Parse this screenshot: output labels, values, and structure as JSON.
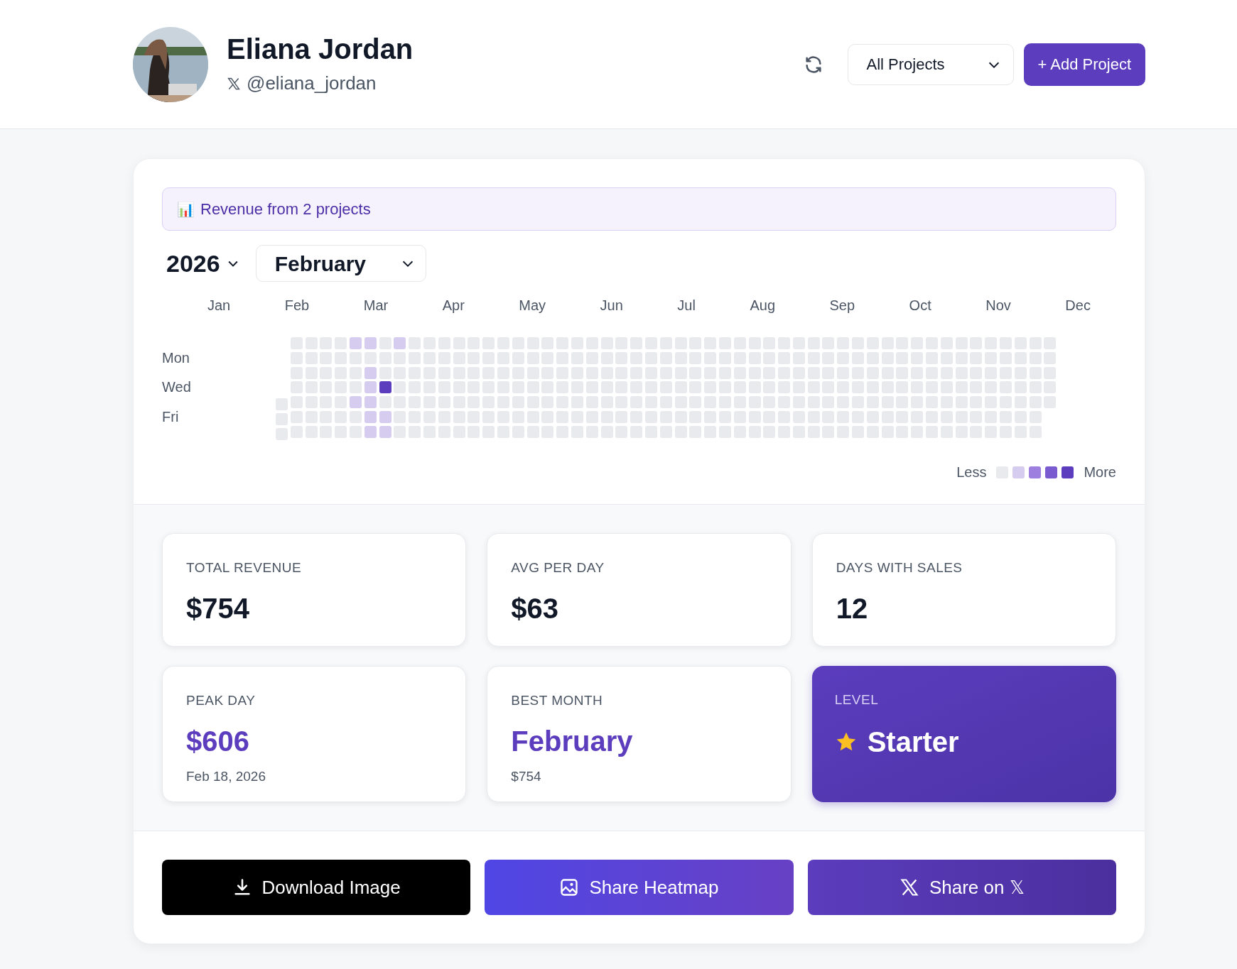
{
  "profile": {
    "name": "Eliana Jordan",
    "handle": "@eliana_jordan"
  },
  "header_controls": {
    "project_select": "All Projects",
    "add_button": "+ Add Project"
  },
  "banner": {
    "icon": "📊",
    "text": "Revenue from 2 projects"
  },
  "period": {
    "year": "2026",
    "month": "February"
  },
  "heatmap": {
    "months": [
      "Jan",
      "Feb",
      "Mar",
      "Apr",
      "May",
      "Jun",
      "Jul",
      "Aug",
      "Sep",
      "Oct",
      "Nov",
      "Dec"
    ],
    "day_labels": [
      "Mon",
      "Wed",
      "Fri"
    ],
    "weeks": [
      {
        "days": [
          {
            "color": "#e9eaee"
          },
          {
            "color": "#e9eaee"
          },
          {
            "color": "#e9eaee"
          }
        ]
      },
      {
        "days": [
          {
            "color": "#e9eaee"
          },
          {
            "color": "#e9eaee"
          },
          {
            "color": "#e9eaee"
          },
          {
            "color": "#e9eaee"
          },
          {
            "color": "#e9eaee"
          },
          {
            "color": "#e9eaee"
          },
          {
            "color": "#e9eaee"
          }
        ]
      },
      {
        "days": [
          {
            "color": "#e9eaee"
          },
          {
            "color": "#e9eaee"
          },
          {
            "color": "#e9eaee"
          },
          {
            "color": "#e9eaee"
          },
          {
            "color": "#e9eaee"
          },
          {
            "color": "#e9eaee"
          },
          {
            "color": "#e9eaee"
          }
        ]
      },
      {
        "days": [
          {
            "color": "#e9eaee"
          },
          {
            "color": "#e9eaee"
          },
          {
            "color": "#e9eaee"
          },
          {
            "color": "#e9eaee"
          },
          {
            "color": "#e9eaee"
          },
          {
            "color": "#e9eaee"
          },
          {
            "color": "#e9eaee"
          }
        ]
      },
      {
        "days": [
          {
            "color": "#e9eaee"
          },
          {
            "color": "#e9eaee"
          },
          {
            "color": "#e9eaee"
          },
          {
            "color": "#e9eaee"
          },
          {
            "color": "#e9eaee"
          },
          {
            "color": "#e9eaee"
          },
          {
            "color": "#e9eaee"
          }
        ]
      },
      {
        "days": [
          {
            "color": "#d6ccf0"
          },
          {
            "color": "#e9eaee"
          },
          {
            "color": "#e9eaee"
          },
          {
            "color": "#e9eaee"
          },
          {
            "color": "#d6ccf0"
          },
          {
            "color": "#e9eaee"
          },
          {
            "color": "#e9eaee"
          }
        ]
      },
      {
        "days": [
          {
            "color": "#d6ccf0"
          },
          {
            "color": "#e9eaee"
          },
          {
            "color": "#d6ccf0"
          },
          {
            "color": "#d6ccf0"
          },
          {
            "color": "#d6ccf0"
          },
          {
            "color": "#d6ccf0"
          },
          {
            "color": "#d6ccf0"
          }
        ]
      },
      {
        "days": [
          {
            "color": "#e9eaee"
          },
          {
            "color": "#e9eaee"
          },
          {
            "color": "#e9eaee"
          },
          {
            "color": "#5b3dbd"
          },
          {
            "color": "#e9eaee"
          },
          {
            "color": "#d6ccf0"
          },
          {
            "color": "#d6ccf0"
          }
        ]
      },
      {
        "days": [
          {
            "color": "#d6ccf0"
          },
          {
            "color": "#e9eaee"
          },
          {
            "color": "#e9eaee"
          },
          {
            "color": "#e9eaee"
          },
          {
            "color": "#e9eaee"
          },
          {
            "color": "#e9eaee"
          },
          {
            "color": "#e9eaee"
          }
        ]
      },
      {
        "days": [
          {
            "color": "#e9eaee"
          },
          {
            "color": "#e9eaee"
          },
          {
            "color": "#e9eaee"
          },
          {
            "color": "#e9eaee"
          },
          {
            "color": "#e9eaee"
          },
          {
            "color": "#e9eaee"
          },
          {
            "color": "#e9eaee"
          }
        ]
      },
      {
        "days": [
          {
            "color": "#e9eaee"
          },
          {
            "color": "#e9eaee"
          },
          {
            "color": "#e9eaee"
          },
          {
            "color": "#e9eaee"
          },
          {
            "color": "#e9eaee"
          },
          {
            "color": "#e9eaee"
          },
          {
            "color": "#e9eaee"
          }
        ]
      },
      {
        "days": [
          {
            "color": "#e9eaee"
          },
          {
            "color": "#e9eaee"
          },
          {
            "color": "#e9eaee"
          },
          {
            "color": "#e9eaee"
          },
          {
            "color": "#e9eaee"
          },
          {
            "color": "#e9eaee"
          },
          {
            "color": "#e9eaee"
          }
        ]
      },
      {
        "days": [
          {
            "color": "#e9eaee"
          },
          {
            "color": "#e9eaee"
          },
          {
            "color": "#e9eaee"
          },
          {
            "color": "#e9eaee"
          },
          {
            "color": "#e9eaee"
          },
          {
            "color": "#e9eaee"
          },
          {
            "color": "#e9eaee"
          }
        ]
      },
      {
        "days": [
          {
            "color": "#e9eaee"
          },
          {
            "color": "#e9eaee"
          },
          {
            "color": "#e9eaee"
          },
          {
            "color": "#e9eaee"
          },
          {
            "color": "#e9eaee"
          },
          {
            "color": "#e9eaee"
          },
          {
            "color": "#e9eaee"
          }
        ]
      },
      {
        "days": [
          {
            "color": "#e9eaee"
          },
          {
            "color": "#e9eaee"
          },
          {
            "color": "#e9eaee"
          },
          {
            "color": "#e9eaee"
          },
          {
            "color": "#e9eaee"
          },
          {
            "color": "#e9eaee"
          },
          {
            "color": "#e9eaee"
          }
        ]
      },
      {
        "days": [
          {
            "color": "#e9eaee"
          },
          {
            "color": "#e9eaee"
          },
          {
            "color": "#e9eaee"
          },
          {
            "color": "#e9eaee"
          },
          {
            "color": "#e9eaee"
          },
          {
            "color": "#e9eaee"
          },
          {
            "color": "#e9eaee"
          }
        ]
      },
      {
        "days": [
          {
            "color": "#e9eaee"
          },
          {
            "color": "#e9eaee"
          },
          {
            "color": "#e9eaee"
          },
          {
            "color": "#e9eaee"
          },
          {
            "color": "#e9eaee"
          },
          {
            "color": "#e9eaee"
          },
          {
            "color": "#e9eaee"
          }
        ]
      },
      {
        "days": [
          {
            "color": "#e9eaee"
          },
          {
            "color": "#e9eaee"
          },
          {
            "color": "#e9eaee"
          },
          {
            "color": "#e9eaee"
          },
          {
            "color": "#e9eaee"
          },
          {
            "color": "#e9eaee"
          },
          {
            "color": "#e9eaee"
          }
        ]
      },
      {
        "days": [
          {
            "color": "#e9eaee"
          },
          {
            "color": "#e9eaee"
          },
          {
            "color": "#e9eaee"
          },
          {
            "color": "#e9eaee"
          },
          {
            "color": "#e9eaee"
          },
          {
            "color": "#e9eaee"
          },
          {
            "color": "#e9eaee"
          }
        ]
      },
      {
        "days": [
          {
            "color": "#e9eaee"
          },
          {
            "color": "#e9eaee"
          },
          {
            "color": "#e9eaee"
          },
          {
            "color": "#e9eaee"
          },
          {
            "color": "#e9eaee"
          },
          {
            "color": "#e9eaee"
          },
          {
            "color": "#e9eaee"
          }
        ]
      },
      {
        "days": [
          {
            "color": "#e9eaee"
          },
          {
            "color": "#e9eaee"
          },
          {
            "color": "#e9eaee"
          },
          {
            "color": "#e9eaee"
          },
          {
            "color": "#e9eaee"
          },
          {
            "color": "#e9eaee"
          },
          {
            "color": "#e9eaee"
          }
        ]
      },
      {
        "days": [
          {
            "color": "#e9eaee"
          },
          {
            "color": "#e9eaee"
          },
          {
            "color": "#e9eaee"
          },
          {
            "color": "#e9eaee"
          },
          {
            "color": "#e9eaee"
          },
          {
            "color": "#e9eaee"
          },
          {
            "color": "#e9eaee"
          }
        ]
      },
      {
        "days": [
          {
            "color": "#e9eaee"
          },
          {
            "color": "#e9eaee"
          },
          {
            "color": "#e9eaee"
          },
          {
            "color": "#e9eaee"
          },
          {
            "color": "#e9eaee"
          },
          {
            "color": "#e9eaee"
          },
          {
            "color": "#e9eaee"
          }
        ]
      },
      {
        "days": [
          {
            "color": "#e9eaee"
          },
          {
            "color": "#e9eaee"
          },
          {
            "color": "#e9eaee"
          },
          {
            "color": "#e9eaee"
          },
          {
            "color": "#e9eaee"
          },
          {
            "color": "#e9eaee"
          },
          {
            "color": "#e9eaee"
          }
        ]
      },
      {
        "days": [
          {
            "color": "#e9eaee"
          },
          {
            "color": "#e9eaee"
          },
          {
            "color": "#e9eaee"
          },
          {
            "color": "#e9eaee"
          },
          {
            "color": "#e9eaee"
          },
          {
            "color": "#e9eaee"
          },
          {
            "color": "#e9eaee"
          }
        ]
      },
      {
        "days": [
          {
            "color": "#e9eaee"
          },
          {
            "color": "#e9eaee"
          },
          {
            "color": "#e9eaee"
          },
          {
            "color": "#e9eaee"
          },
          {
            "color": "#e9eaee"
          },
          {
            "color": "#e9eaee"
          },
          {
            "color": "#e9eaee"
          }
        ]
      },
      {
        "days": [
          {
            "color": "#e9eaee"
          },
          {
            "color": "#e9eaee"
          },
          {
            "color": "#e9eaee"
          },
          {
            "color": "#e9eaee"
          },
          {
            "color": "#e9eaee"
          },
          {
            "color": "#e9eaee"
          },
          {
            "color": "#e9eaee"
          }
        ]
      },
      {
        "days": [
          {
            "color": "#e9eaee"
          },
          {
            "color": "#e9eaee"
          },
          {
            "color": "#e9eaee"
          },
          {
            "color": "#e9eaee"
          },
          {
            "color": "#e9eaee"
          },
          {
            "color": "#e9eaee"
          },
          {
            "color": "#e9eaee"
          }
        ]
      },
      {
        "days": [
          {
            "color": "#e9eaee"
          },
          {
            "color": "#e9eaee"
          },
          {
            "color": "#e9eaee"
          },
          {
            "color": "#e9eaee"
          },
          {
            "color": "#e9eaee"
          },
          {
            "color": "#e9eaee"
          },
          {
            "color": "#e9eaee"
          }
        ]
      },
      {
        "days": [
          {
            "color": "#e9eaee"
          },
          {
            "color": "#e9eaee"
          },
          {
            "color": "#e9eaee"
          },
          {
            "color": "#e9eaee"
          },
          {
            "color": "#e9eaee"
          },
          {
            "color": "#e9eaee"
          },
          {
            "color": "#e9eaee"
          }
        ]
      },
      {
        "days": [
          {
            "color": "#e9eaee"
          },
          {
            "color": "#e9eaee"
          },
          {
            "color": "#e9eaee"
          },
          {
            "color": "#e9eaee"
          },
          {
            "color": "#e9eaee"
          },
          {
            "color": "#e9eaee"
          },
          {
            "color": "#e9eaee"
          }
        ]
      },
      {
        "days": [
          {
            "color": "#e9eaee"
          },
          {
            "color": "#e9eaee"
          },
          {
            "color": "#e9eaee"
          },
          {
            "color": "#e9eaee"
          },
          {
            "color": "#e9eaee"
          },
          {
            "color": "#e9eaee"
          },
          {
            "color": "#e9eaee"
          }
        ]
      },
      {
        "days": [
          {
            "color": "#e9eaee"
          },
          {
            "color": "#e9eaee"
          },
          {
            "color": "#e9eaee"
          },
          {
            "color": "#e9eaee"
          },
          {
            "color": "#e9eaee"
          },
          {
            "color": "#e9eaee"
          },
          {
            "color": "#e9eaee"
          }
        ]
      },
      {
        "days": [
          {
            "color": "#e9eaee"
          },
          {
            "color": "#e9eaee"
          },
          {
            "color": "#e9eaee"
          },
          {
            "color": "#e9eaee"
          },
          {
            "color": "#e9eaee"
          },
          {
            "color": "#e9eaee"
          },
          {
            "color": "#e9eaee"
          }
        ]
      },
      {
        "days": [
          {
            "color": "#e9eaee"
          },
          {
            "color": "#e9eaee"
          },
          {
            "color": "#e9eaee"
          },
          {
            "color": "#e9eaee"
          },
          {
            "color": "#e9eaee"
          },
          {
            "color": "#e9eaee"
          },
          {
            "color": "#e9eaee"
          }
        ]
      },
      {
        "days": [
          {
            "color": "#e9eaee"
          },
          {
            "color": "#e9eaee"
          },
          {
            "color": "#e9eaee"
          },
          {
            "color": "#e9eaee"
          },
          {
            "color": "#e9eaee"
          },
          {
            "color": "#e9eaee"
          },
          {
            "color": "#e9eaee"
          }
        ]
      },
      {
        "days": [
          {
            "color": "#e9eaee"
          },
          {
            "color": "#e9eaee"
          },
          {
            "color": "#e9eaee"
          },
          {
            "color": "#e9eaee"
          },
          {
            "color": "#e9eaee"
          },
          {
            "color": "#e9eaee"
          },
          {
            "color": "#e9eaee"
          }
        ]
      },
      {
        "days": [
          {
            "color": "#e9eaee"
          },
          {
            "color": "#e9eaee"
          },
          {
            "color": "#e9eaee"
          },
          {
            "color": "#e9eaee"
          },
          {
            "color": "#e9eaee"
          },
          {
            "color": "#e9eaee"
          },
          {
            "color": "#e9eaee"
          }
        ]
      },
      {
        "days": [
          {
            "color": "#e9eaee"
          },
          {
            "color": "#e9eaee"
          },
          {
            "color": "#e9eaee"
          },
          {
            "color": "#e9eaee"
          },
          {
            "color": "#e9eaee"
          },
          {
            "color": "#e9eaee"
          },
          {
            "color": "#e9eaee"
          }
        ]
      },
      {
        "days": [
          {
            "color": "#e9eaee"
          },
          {
            "color": "#e9eaee"
          },
          {
            "color": "#e9eaee"
          },
          {
            "color": "#e9eaee"
          },
          {
            "color": "#e9eaee"
          },
          {
            "color": "#e9eaee"
          },
          {
            "color": "#e9eaee"
          }
        ]
      },
      {
        "days": [
          {
            "color": "#e9eaee"
          },
          {
            "color": "#e9eaee"
          },
          {
            "color": "#e9eaee"
          },
          {
            "color": "#e9eaee"
          },
          {
            "color": "#e9eaee"
          },
          {
            "color": "#e9eaee"
          },
          {
            "color": "#e9eaee"
          }
        ]
      },
      {
        "days": [
          {
            "color": "#e9eaee"
          },
          {
            "color": "#e9eaee"
          },
          {
            "color": "#e9eaee"
          },
          {
            "color": "#e9eaee"
          },
          {
            "color": "#e9eaee"
          },
          {
            "color": "#e9eaee"
          },
          {
            "color": "#e9eaee"
          }
        ]
      },
      {
        "days": [
          {
            "color": "#e9eaee"
          },
          {
            "color": "#e9eaee"
          },
          {
            "color": "#e9eaee"
          },
          {
            "color": "#e9eaee"
          },
          {
            "color": "#e9eaee"
          },
          {
            "color": "#e9eaee"
          },
          {
            "color": "#e9eaee"
          }
        ]
      },
      {
        "days": [
          {
            "color": "#e9eaee"
          },
          {
            "color": "#e9eaee"
          },
          {
            "color": "#e9eaee"
          },
          {
            "color": "#e9eaee"
          },
          {
            "color": "#e9eaee"
          },
          {
            "color": "#e9eaee"
          },
          {
            "color": "#e9eaee"
          }
        ]
      },
      {
        "days": [
          {
            "color": "#e9eaee"
          },
          {
            "color": "#e9eaee"
          },
          {
            "color": "#e9eaee"
          },
          {
            "color": "#e9eaee"
          },
          {
            "color": "#e9eaee"
          },
          {
            "color": "#e9eaee"
          },
          {
            "color": "#e9eaee"
          }
        ]
      },
      {
        "days": [
          {
            "color": "#e9eaee"
          },
          {
            "color": "#e9eaee"
          },
          {
            "color": "#e9eaee"
          },
          {
            "color": "#e9eaee"
          },
          {
            "color": "#e9eaee"
          },
          {
            "color": "#e9eaee"
          },
          {
            "color": "#e9eaee"
          }
        ]
      },
      {
        "days": [
          {
            "color": "#e9eaee"
          },
          {
            "color": "#e9eaee"
          },
          {
            "color": "#e9eaee"
          },
          {
            "color": "#e9eaee"
          },
          {
            "color": "#e9eaee"
          },
          {
            "color": "#e9eaee"
          },
          {
            "color": "#e9eaee"
          }
        ]
      },
      {
        "days": [
          {
            "color": "#e9eaee"
          },
          {
            "color": "#e9eaee"
          },
          {
            "color": "#e9eaee"
          },
          {
            "color": "#e9eaee"
          },
          {
            "color": "#e9eaee"
          },
          {
            "color": "#e9eaee"
          },
          {
            "color": "#e9eaee"
          }
        ]
      },
      {
        "days": [
          {
            "color": "#e9eaee"
          },
          {
            "color": "#e9eaee"
          },
          {
            "color": "#e9eaee"
          },
          {
            "color": "#e9eaee"
          },
          {
            "color": "#e9eaee"
          },
          {
            "color": "#e9eaee"
          },
          {
            "color": "#e9eaee"
          }
        ]
      },
      {
        "days": [
          {
            "color": "#e9eaee"
          },
          {
            "color": "#e9eaee"
          },
          {
            "color": "#e9eaee"
          },
          {
            "color": "#e9eaee"
          },
          {
            "color": "#e9eaee"
          },
          {
            "color": "#e9eaee"
          },
          {
            "color": "#e9eaee"
          }
        ]
      },
      {
        "days": [
          {
            "color": "#e9eaee"
          },
          {
            "color": "#e9eaee"
          },
          {
            "color": "#e9eaee"
          },
          {
            "color": "#e9eaee"
          },
          {
            "color": "#e9eaee"
          },
          {
            "color": "#e9eaee"
          },
          {
            "color": "#e9eaee"
          }
        ]
      },
      {
        "days": [
          {
            "color": "#e9eaee"
          },
          {
            "color": "#e9eaee"
          },
          {
            "color": "#e9eaee"
          },
          {
            "color": "#e9eaee"
          },
          {
            "color": "#e9eaee"
          },
          {
            "color": "#e9eaee"
          },
          {
            "color": "#e9eaee"
          }
        ]
      },
      {
        "days": [
          {
            "color": "#e9eaee"
          },
          {
            "color": "#e9eaee"
          },
          {
            "color": "#e9eaee"
          },
          {
            "color": "#e9eaee"
          },
          {
            "color": "#e9eaee"
          }
        ]
      }
    ],
    "legend": {
      "less": "Less",
      "more": "More",
      "swatches": [
        {
          "color": "#e9eaee"
        },
        {
          "color": "#d6ccf0"
        },
        {
          "color": "#9d7fe0"
        },
        {
          "color": "#7a5bd0"
        },
        {
          "color": "#5b3dbd"
        }
      ]
    }
  },
  "stats": [
    {
      "kind": "plain",
      "label": "TOTAL REVENUE",
      "value": "$754"
    },
    {
      "kind": "plain",
      "label": "AVG PER DAY",
      "value": "$63"
    },
    {
      "kind": "plain",
      "label": "DAYS WITH SALES",
      "value": "12"
    },
    {
      "kind": "accent",
      "label": "PEAK DAY",
      "value": "$606",
      "sub": "Feb 18, 2026"
    },
    {
      "kind": "accent",
      "label": "BEST MONTH",
      "value": "February",
      "sub": "$754"
    },
    {
      "kind": "level",
      "label": "LEVEL",
      "value": "Starter"
    }
  ],
  "actions": [
    {
      "kind": "download",
      "label": "Download Image"
    },
    {
      "kind": "share",
      "label": "Share Heatmap"
    },
    {
      "kind": "x",
      "label": "Share on 𝕏"
    }
  ]
}
